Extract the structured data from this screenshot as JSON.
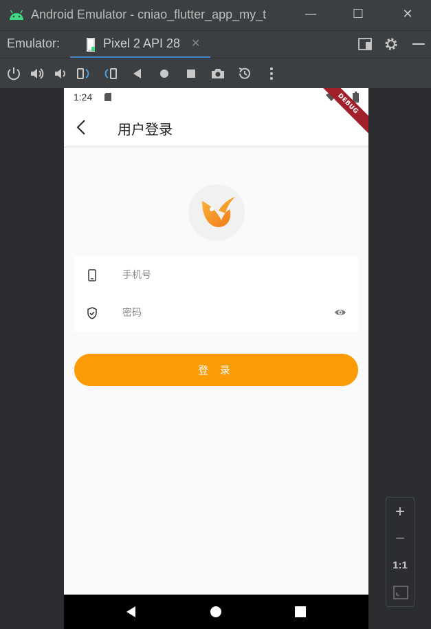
{
  "window": {
    "title": "Android Emulator - cniao_flutter_app_my_t",
    "minimize_glyph": "—",
    "maximize_glyph": "☐",
    "close_glyph": "✕"
  },
  "tabs": {
    "label": "Emulator:",
    "device_tab": "Pixel 2 API 28",
    "close_glyph": "✕"
  },
  "toolbar": {
    "icons": [
      "power-icon",
      "volume-up-icon",
      "volume-down-icon",
      "rotate-left-icon",
      "rotate-right-icon",
      "back-icon",
      "home-icon",
      "overview-icon",
      "screenshot-icon",
      "snapshot-icon",
      "more-icon"
    ]
  },
  "device": {
    "status_time": "1:24",
    "debug_banner": "DEBUG",
    "app_bar_title": "用户登录",
    "phone_placeholder": "手机号",
    "password_placeholder": "密码",
    "login_button": "登 录"
  },
  "zoom": {
    "zoom_in": "+",
    "zoom_out": "−",
    "one_to_one": "1:1"
  },
  "colors": {
    "accent": "#fb9b05",
    "debug_banner": "#a0202c",
    "tab_underline": "#4a88c7"
  }
}
